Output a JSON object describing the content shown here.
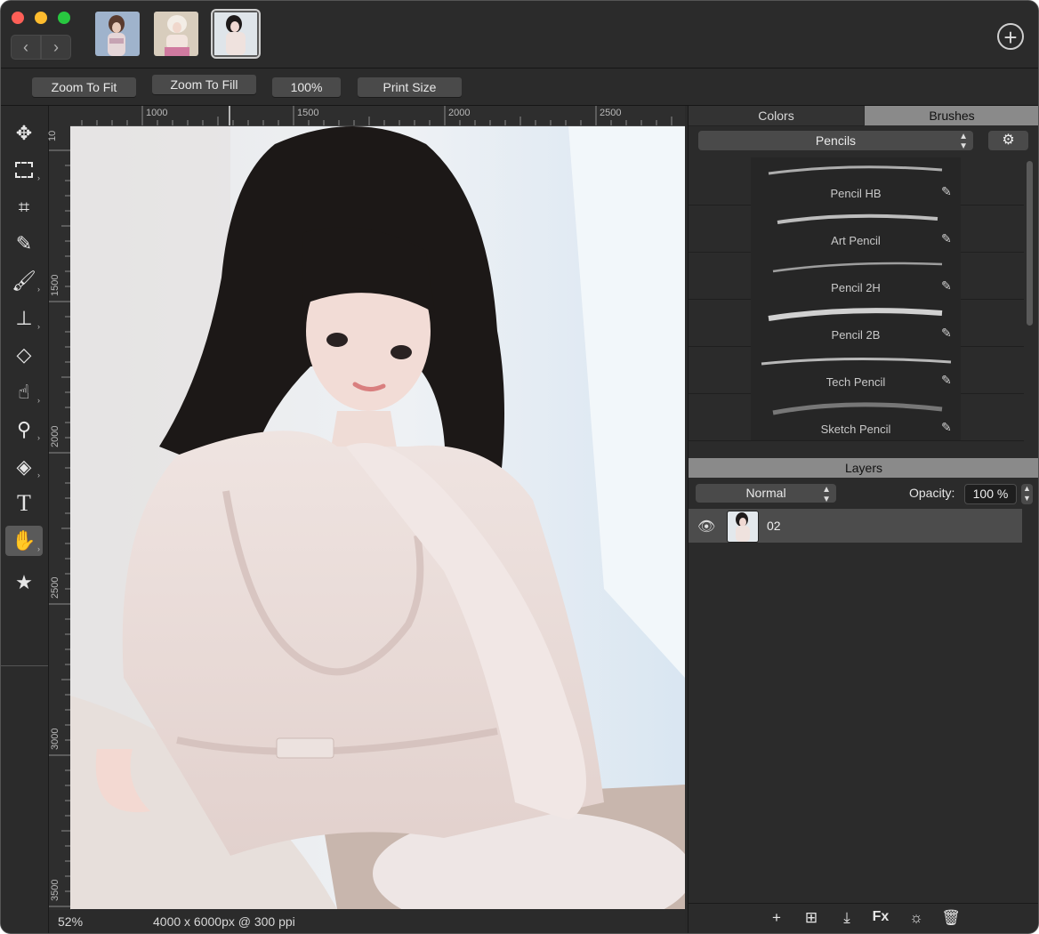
{
  "zoom_buttons": {
    "fit": "Zoom To Fit",
    "fill": "Zoom To Fill",
    "actual": "100%",
    "print": "Print Size"
  },
  "ruler": {
    "top_labels": [
      "1000",
      "1500",
      "2000",
      "2500"
    ],
    "left_labels": [
      "10",
      "1500",
      "2000",
      "2500",
      "3000",
      "3500"
    ]
  },
  "status": {
    "zoom": "52%",
    "dimensions": "4000 x 6000px @ 300 ppi"
  },
  "panel_tabs": {
    "colors": "Colors",
    "brushes": "Brushes"
  },
  "brush_category": "Pencils",
  "brushes": [
    "Pencil HB",
    "Art Pencil",
    "Pencil 2H",
    "Pencil 2B",
    "Tech Pencil",
    "Sketch Pencil"
  ],
  "layers": {
    "header": "Layers",
    "blend_mode": "Normal",
    "opacity_label": "Opacity:",
    "opacity_value": "100 %",
    "items": [
      {
        "name": "02"
      }
    ]
  },
  "icons": {
    "nav_back": "chevron-left-icon",
    "nav_forward": "chevron-right-icon",
    "new_tab": "plus-circle-icon",
    "tools": [
      "move-icon",
      "marquee-icon",
      "crop-icon",
      "eyedropper-icon",
      "brush-icon",
      "stamp-icon",
      "eraser-icon",
      "smudge-icon",
      "dodge-icon",
      "fill-icon",
      "text-icon",
      "hand-icon",
      "star-icon"
    ],
    "layer_footer": [
      "add-layer-icon",
      "add-group-icon",
      "merge-down-icon",
      "fx-icon",
      "adjust-icon",
      "trash-icon"
    ]
  }
}
